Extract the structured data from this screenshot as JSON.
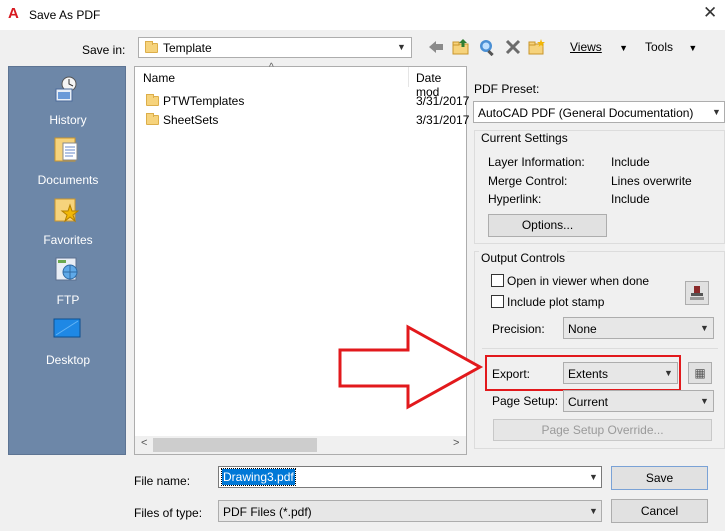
{
  "window": {
    "title": "Save As PDF",
    "app_icon": "autocad-a-icon"
  },
  "save_in": {
    "label": "Save in:",
    "value": "Template"
  },
  "toolbar": {
    "icons": [
      "back-arrow-icon",
      "up-folder-icon",
      "search-web-icon",
      "delete-icon",
      "new-folder-icon"
    ],
    "views_label": "Views",
    "tools_label": "Tools"
  },
  "places": [
    {
      "label": "History",
      "icon": "history-icon"
    },
    {
      "label": "Documents",
      "icon": "documents-icon"
    },
    {
      "label": "Favorites",
      "icon": "favorites-icon"
    },
    {
      "label": "FTP",
      "icon": "ftp-icon"
    },
    {
      "label": "Desktop",
      "icon": "desktop-icon"
    }
  ],
  "file_list": {
    "columns": {
      "name": "Name",
      "date": "Date mod"
    },
    "rows": [
      {
        "name": "PTWTemplates",
        "date": "3/31/2017"
      },
      {
        "name": "SheetSets",
        "date": "3/31/2017"
      }
    ]
  },
  "pdf_preset": {
    "label": "PDF Preset:",
    "value": "AutoCAD PDF (General Documentation)"
  },
  "current_settings": {
    "title": "Current Settings",
    "rows": [
      {
        "label": "Layer Information:",
        "value": "Include"
      },
      {
        "label": "Merge Control:",
        "value": "Lines overwrite"
      },
      {
        "label": "Hyperlink:",
        "value": "Include"
      }
    ],
    "options_button": "Options..."
  },
  "output_controls": {
    "title": "Output Controls",
    "open_in_viewer": {
      "label": "Open in viewer when done",
      "checked": false
    },
    "include_plot_stamp": {
      "label": "Include plot stamp",
      "checked": false
    },
    "precision": {
      "label": "Precision:",
      "value": "None"
    },
    "export": {
      "label": "Export:",
      "value": "Extents"
    },
    "page_setup": {
      "label": "Page Setup:",
      "value": "Current"
    },
    "page_setup_override_button": "Page Setup Override..."
  },
  "file_name": {
    "label": "File name:",
    "value": "Drawing3.pdf"
  },
  "files_of_type": {
    "label": "Files of type:",
    "value": "PDF Files (*.pdf)"
  },
  "buttons": {
    "save": "Save",
    "cancel": "Cancel"
  },
  "colors": {
    "annotation_red": "#e2191c",
    "places_bar": "#6d87a8",
    "selection_blue": "#0078d7"
  }
}
